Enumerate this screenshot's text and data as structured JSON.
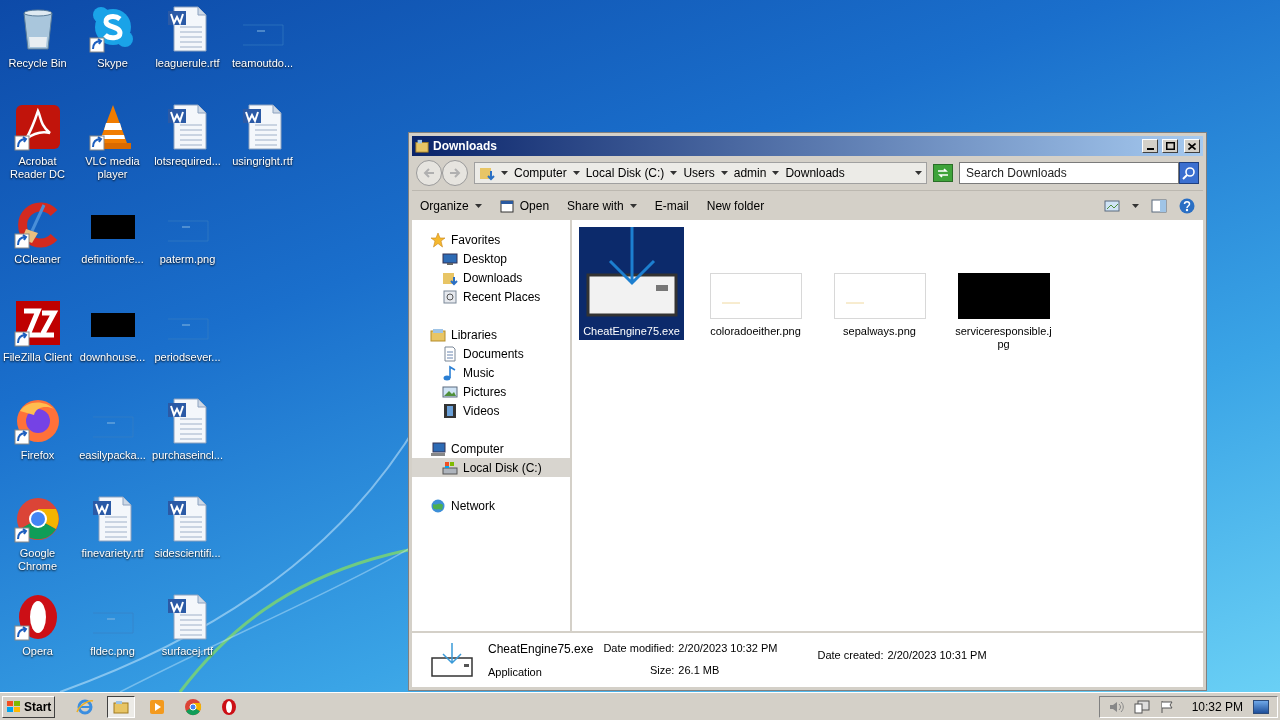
{
  "desktop": {
    "columns": [
      [
        {
          "label": "Recycle Bin",
          "kind": "recycle",
          "shortcut": false
        },
        {
          "label": "Acrobat Reader DC",
          "kind": "acrobat",
          "shortcut": true
        },
        {
          "label": "CCleaner",
          "kind": "ccleaner",
          "shortcut": true
        },
        {
          "label": "FileZilla Client",
          "kind": "filezilla",
          "shortcut": true
        },
        {
          "label": "Firefox",
          "kind": "firefox",
          "shortcut": true
        },
        {
          "label": "Google Chrome",
          "kind": "chrome",
          "shortcut": true
        },
        {
          "label": "Opera",
          "kind": "opera",
          "shortcut": true
        }
      ],
      [
        {
          "label": "Skype",
          "kind": "skype",
          "shortcut": true
        },
        {
          "label": "VLC media player",
          "kind": "vlc",
          "shortcut": true
        },
        {
          "label": "definitionfe...",
          "kind": "image-dark",
          "shortcut": false
        },
        {
          "label": "downhouse...",
          "kind": "image-dark",
          "shortcut": false
        },
        {
          "label": "easilypacka...",
          "kind": "image",
          "shortcut": false
        },
        {
          "label": "finevariety.rtf",
          "kind": "word",
          "shortcut": false
        },
        {
          "label": "fldec.png",
          "kind": "image",
          "shortcut": false
        }
      ],
      [
        {
          "label": "leaguerule.rtf",
          "kind": "word",
          "shortcut": false
        },
        {
          "label": "lotsrequired...",
          "kind": "word",
          "shortcut": false
        },
        {
          "label": "paterm.png",
          "kind": "image",
          "shortcut": false
        },
        {
          "label": "periodsever...",
          "kind": "image",
          "shortcut": false
        },
        {
          "label": "purchaseincl...",
          "kind": "word",
          "shortcut": false
        },
        {
          "label": "sidescientifi...",
          "kind": "word",
          "shortcut": false
        },
        {
          "label": "surfacej.rtf",
          "kind": "word",
          "shortcut": false
        }
      ],
      [
        {
          "label": "teamoutdo...",
          "kind": "image",
          "shortcut": false
        },
        {
          "label": "usingright.rtf",
          "kind": "word",
          "shortcut": false
        }
      ]
    ]
  },
  "window": {
    "title": "Downloads",
    "breadcrumb": [
      "Computer",
      "Local Disk (C:)",
      "Users",
      "admin",
      "Downloads"
    ],
    "search": {
      "placeholder": "Search Downloads"
    },
    "toolbar": [
      {
        "label": "Organize",
        "kind": "dropdown"
      },
      {
        "label": "Open",
        "kind": "icon"
      },
      {
        "label": "Share with",
        "kind": "dropdown"
      },
      {
        "label": "E-mail",
        "kind": "plain"
      },
      {
        "label": "New folder",
        "kind": "plain"
      }
    ],
    "nav": [
      {
        "label": "Favorites",
        "kind": "star",
        "selected": false,
        "children": [
          {
            "label": "Desktop",
            "kind": "desktop",
            "selected": false
          },
          {
            "label": "Downloads",
            "kind": "downloads",
            "selected": false
          },
          {
            "label": "Recent Places",
            "kind": "recent",
            "selected": false
          }
        ]
      },
      {
        "label": "Libraries",
        "kind": "library",
        "selected": false,
        "children": [
          {
            "label": "Documents",
            "kind": "documents",
            "selected": false
          },
          {
            "label": "Music",
            "kind": "music",
            "selected": false
          },
          {
            "label": "Pictures",
            "kind": "pictures",
            "selected": false
          },
          {
            "label": "Videos",
            "kind": "videos",
            "selected": false
          }
        ]
      },
      {
        "label": "Computer",
        "kind": "computer",
        "selected": false,
        "children": [
          {
            "label": "Local Disk (C:)",
            "kind": "disk",
            "selected": true
          }
        ]
      },
      {
        "label": "Network",
        "kind": "network",
        "selected": false
      }
    ],
    "files": [
      {
        "name": "CheatEngine75.exe",
        "kind": "installer",
        "selected": true
      },
      {
        "name": "coloradoeither.png",
        "kind": "image-light",
        "selected": false
      },
      {
        "name": "sepalways.png",
        "kind": "image-light",
        "selected": false
      },
      {
        "name": "serviceresponsible.jpg",
        "kind": "image-dark",
        "selected": false
      }
    ],
    "details": {
      "name": "CheatEngine75.exe",
      "type": "Application",
      "fields": [
        {
          "label": "Date modified:",
          "value": "2/20/2023 10:32 PM"
        },
        {
          "label": "Size:",
          "value": "26.1 MB"
        },
        {
          "label": "Date created:",
          "value": "2/20/2023 10:31 PM"
        }
      ]
    }
  },
  "taskbar": {
    "start": "Start",
    "apps": [
      {
        "kind": "ie",
        "selected": false
      },
      {
        "kind": "explorer",
        "selected": true
      },
      {
        "kind": "media",
        "selected": false
      },
      {
        "kind": "chrome",
        "selected": false
      },
      {
        "kind": "opera",
        "selected": false
      }
    ],
    "time": "10:32 PM"
  }
}
